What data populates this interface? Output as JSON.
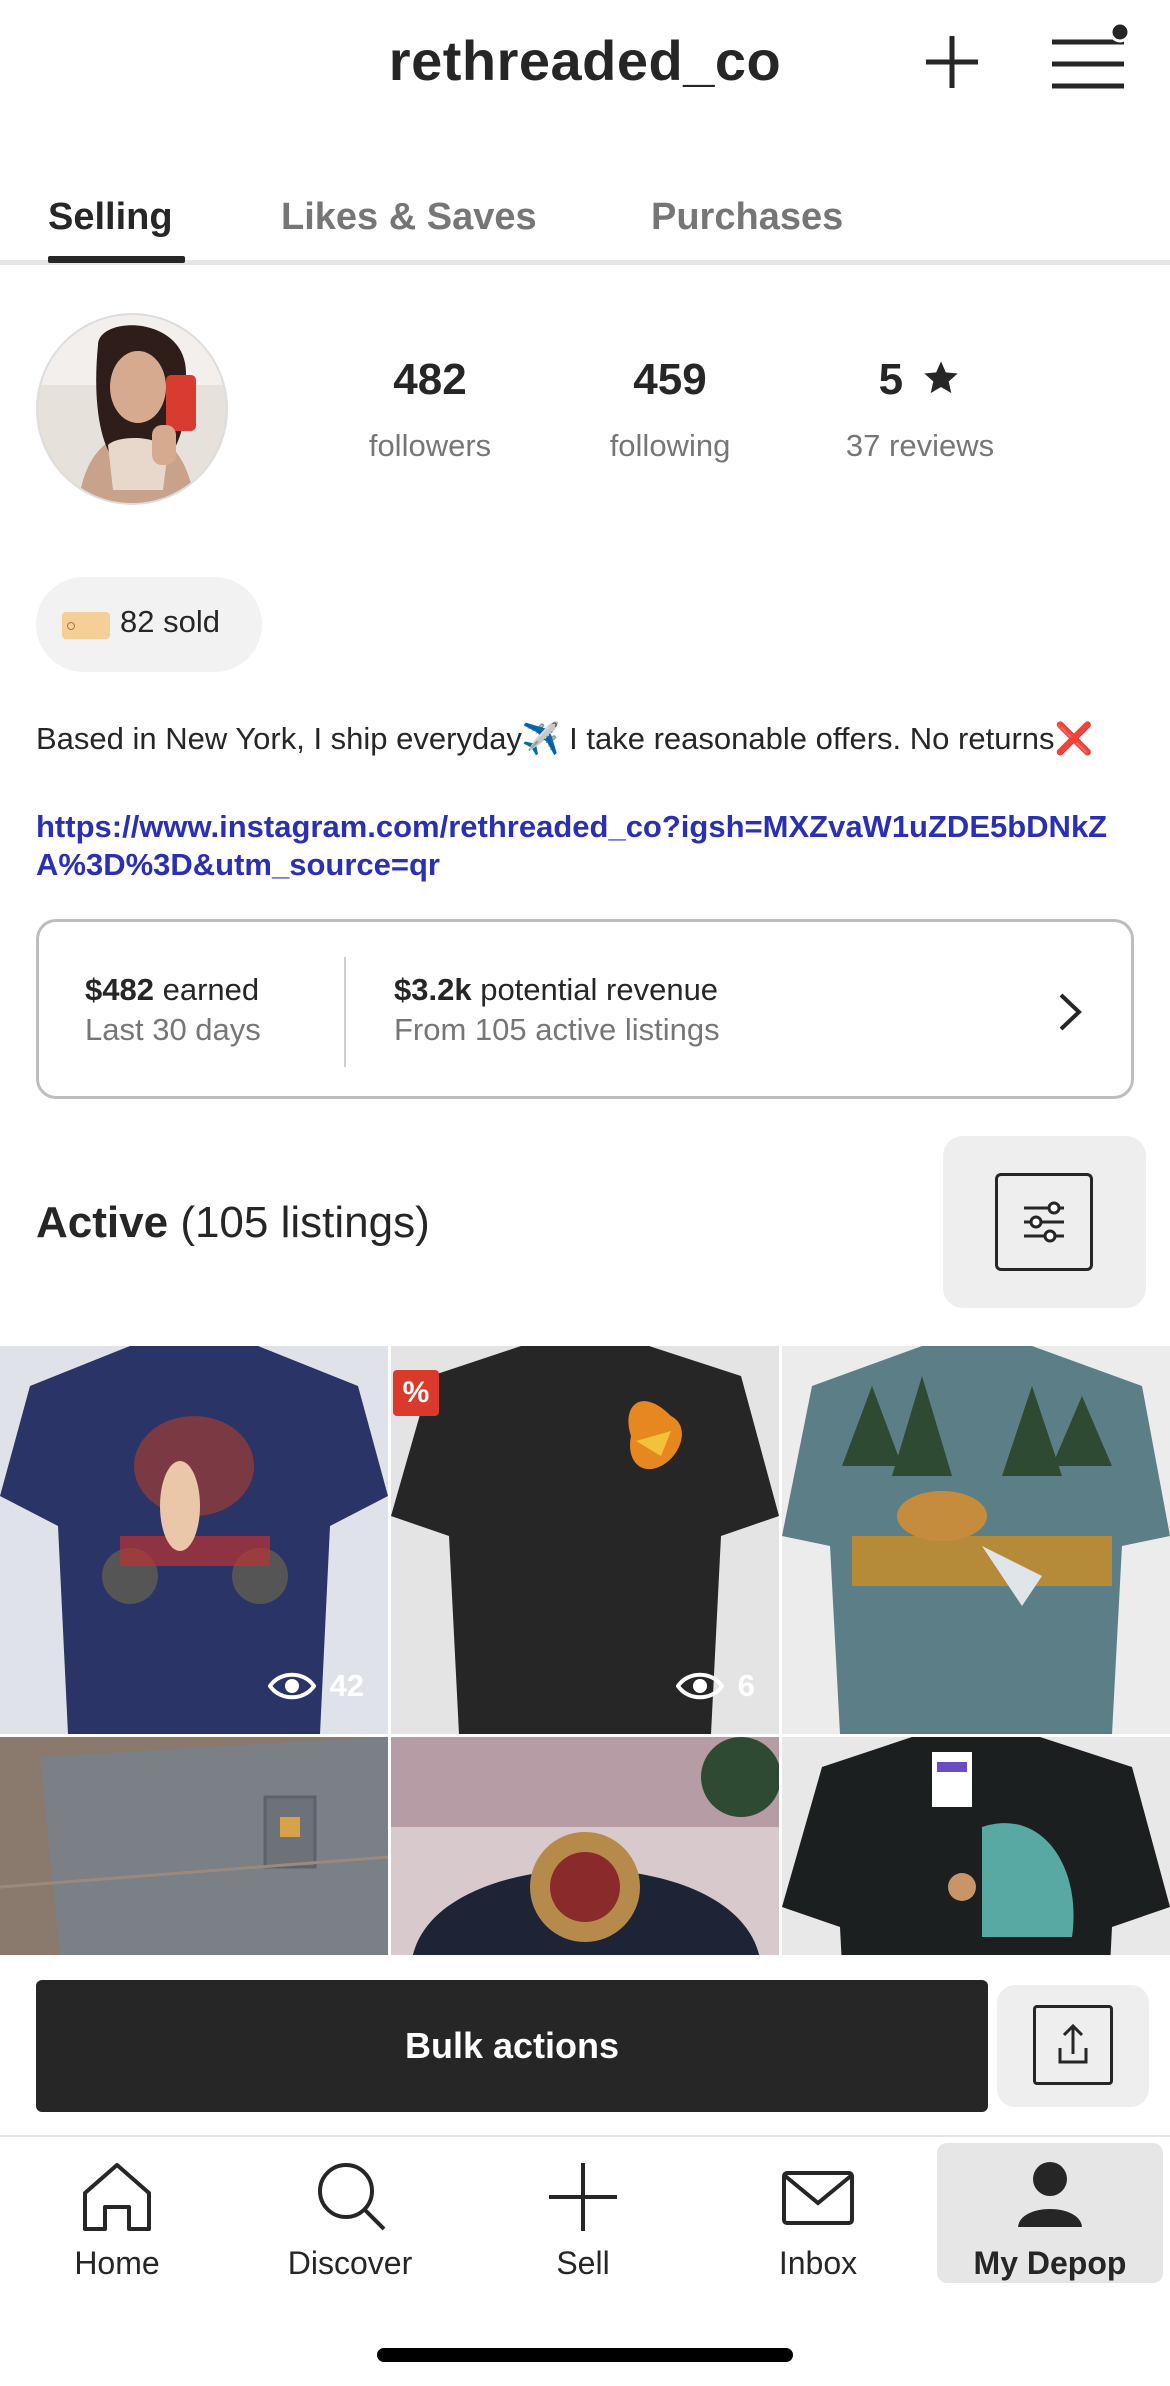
{
  "header": {
    "username": "rethreaded_co"
  },
  "tabs": [
    {
      "label": "Selling",
      "active": true
    },
    {
      "label": "Likes & Saves",
      "active": false
    },
    {
      "label": "Purchases",
      "active": false
    }
  ],
  "stats": {
    "followers": {
      "value": "482",
      "label": "followers"
    },
    "following": {
      "value": "459",
      "label": "following"
    },
    "rating": {
      "value": "5",
      "label": "37 reviews"
    }
  },
  "sold": {
    "label": "82 sold"
  },
  "bio": {
    "text": "Based in New York, I ship everyday✈️ I take reasonable offers. No returns❌",
    "link": "https://www.instagram.com/rethreaded_co?igsh=MXZvaW1uZDE5bDNkZA%3D%3D&utm_source=qr"
  },
  "earnings": {
    "earned_amount": "$482",
    "earned_label": "earned",
    "earned_period": "Last 30 days",
    "revenue_amount": "$3.2k",
    "revenue_label": "potential revenue",
    "revenue_from": "From 105 active listings"
  },
  "active": {
    "title": "Active",
    "count": "(105 listings)"
  },
  "listings": [
    {
      "views": "42",
      "discount": false,
      "bg": "#2a3466"
    },
    {
      "views": "6",
      "discount": true,
      "badge": "%",
      "bg": "#262626"
    },
    {
      "views": "",
      "discount": false,
      "bg": "#5c7f87"
    },
    {
      "views": "",
      "discount": false,
      "bg": "#7b7f86"
    },
    {
      "views": "",
      "discount": false,
      "bg": "#1d2436"
    },
    {
      "views": "",
      "discount": false,
      "bg": "#1c1f1f"
    }
  ],
  "actions": {
    "bulk_label": "Bulk actions"
  },
  "nav": [
    {
      "label": "Home",
      "icon": "home-icon",
      "active": false
    },
    {
      "label": "Discover",
      "icon": "search-icon",
      "active": false
    },
    {
      "label": "Sell",
      "icon": "plus-icon",
      "active": false
    },
    {
      "label": "Inbox",
      "icon": "mail-icon",
      "active": false
    },
    {
      "label": "My Depop",
      "icon": "user-icon",
      "active": true
    }
  ]
}
